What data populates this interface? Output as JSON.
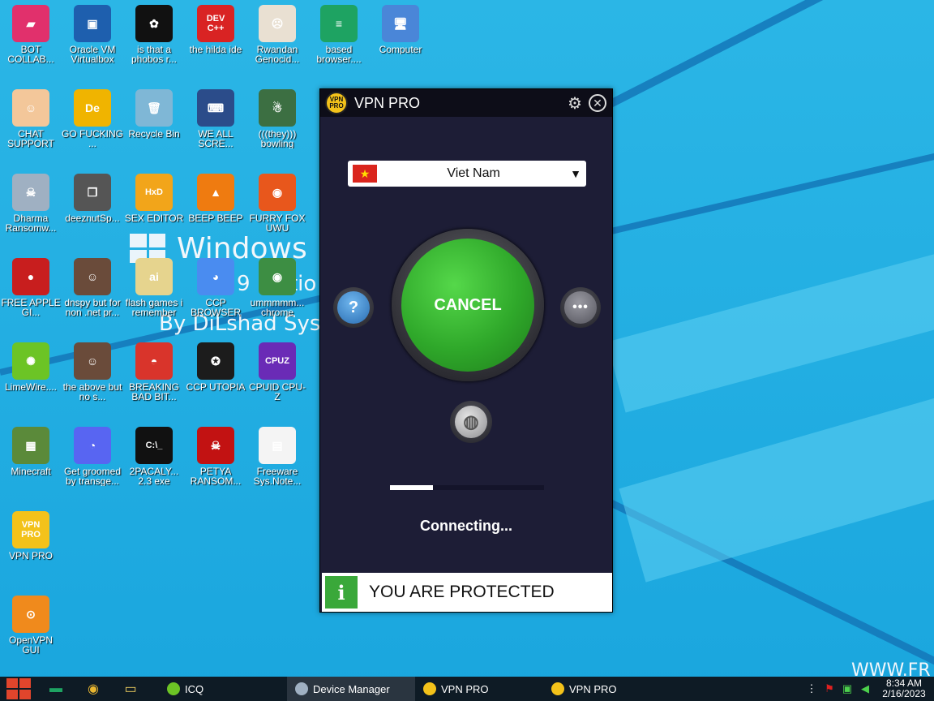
{
  "desktop": {
    "icons": [
      {
        "label": "BOT COLLAB...",
        "glyph": "▰",
        "color": "#e1306c"
      },
      {
        "label": "Oracle VM Virtualbox",
        "glyph": "▣",
        "color": "#1e5fae"
      },
      {
        "label": "is that a phobos r...",
        "glyph": "✿",
        "color": "#111111"
      },
      {
        "label": "the hilda ide",
        "glyph": "DEV C++",
        "color": "#d92323"
      },
      {
        "label": "Rwandan Genocid...",
        "glyph": "☹",
        "color": "#e9e0d2"
      },
      {
        "label": "based browser....",
        "glyph": "≡",
        "color": "#1ea362"
      },
      {
        "label": "Computer",
        "glyph": "🖥",
        "color": "#4a86d8"
      },
      {
        "label": "CHAT SUPPORT",
        "glyph": "☺",
        "color": "#f3c79a"
      },
      {
        "label": "GO FUCKING ...",
        "glyph": "De",
        "color": "#f0b400"
      },
      {
        "label": "Recycle Bin",
        "glyph": "🗑",
        "color": "#7fb7d6"
      },
      {
        "label": "WE ALL SCRE...",
        "glyph": "⌨",
        "color": "#2b4c8a"
      },
      {
        "label": "(((they))) bowling",
        "glyph": "☃",
        "color": "#3c6f42"
      },
      {
        "label": "Dharma Ransomw...",
        "glyph": "☠",
        "color": "#9fb0c2"
      },
      {
        "label": "deeznutSp...",
        "glyph": "❐",
        "color": "#555555"
      },
      {
        "label": "SEX EDITOR",
        "glyph": "HxD",
        "color": "#f2a51a"
      },
      {
        "label": "BEEP BEEP",
        "glyph": "▲",
        "color": "#ef7b10"
      },
      {
        "label": "FURRY FOX UWU",
        "glyph": "◉",
        "color": "#e8571c"
      },
      {
        "label": "FREE APPLE GI...",
        "glyph": "●",
        "color": "#c81e1e"
      },
      {
        "label": "dnspy but for non .net pr...",
        "glyph": "☺",
        "color": "#6a4b3a"
      },
      {
        "label": "flash games i remember",
        "glyph": "ai",
        "color": "#e6d48e"
      },
      {
        "label": "CCP BROWSER",
        "glyph": "◕",
        "color": "#4a8cf0"
      },
      {
        "label": "ummmmm... chrome",
        "glyph": "◉",
        "color": "#3d8e43"
      },
      {
        "label": "LimeWire....",
        "glyph": "✺",
        "color": "#6cc425"
      },
      {
        "label": "the above but no s...",
        "glyph": "☺",
        "color": "#6a4b3a"
      },
      {
        "label": "BREAKING BAD BIT...",
        "glyph": "◓",
        "color": "#d9342b"
      },
      {
        "label": "CCP UTOPIA",
        "glyph": "✪",
        "color": "#1c1c1c"
      },
      {
        "label": "CPUID CPU-Z",
        "glyph": "CPUZ",
        "color": "#6a2bb6"
      },
      {
        "label": "Minecraft",
        "glyph": "▦",
        "color": "#5b8a3a"
      },
      {
        "label": "Get groomed by transge...",
        "glyph": "◔",
        "color": "#5865f2"
      },
      {
        "label": "2PACALY... 2.3 exe",
        "glyph": "C:\\_",
        "color": "#111111"
      },
      {
        "label": "PETYA RANSOM...",
        "glyph": "☠",
        "color": "#c21212"
      },
      {
        "label": "Freeware Sys.Note...",
        "glyph": "▤",
        "color": "#f4f4f4"
      },
      {
        "label": "VPN PRO",
        "glyph": "VPN PRO",
        "color": "#f3c21a"
      },
      {
        "label": "OpenVPN GUI",
        "glyph": "⊙",
        "color": "#f08a1c"
      }
    ],
    "wallpaper": {
      "brand": "Windows",
      "edition_fragment": "9 Editio",
      "credit": "By DiLshad Sys",
      "watermark_fragment": "WWW.FR"
    }
  },
  "vpn_window": {
    "title": "VPN PRO",
    "logo_text": "VPN PRO",
    "settings_icon": "gear-icon",
    "close_icon": "close-icon",
    "country": "Viet Nam",
    "country_flag": "vietnam-flag-icon",
    "main_button_label": "CANCEL",
    "help_label": "?",
    "more_label": "•••",
    "progress": 0.28,
    "status": "Connecting...",
    "protected_label": "YOU ARE PROTECTED",
    "info_label": "i",
    "accent_color": "#2fa82a",
    "bg_color": "#1d1d36"
  },
  "taskbar": {
    "tasks": [
      {
        "label": "ICQ",
        "icon": "icq-icon",
        "color": "#6cc425",
        "active": false
      },
      {
        "label": "Device Manager",
        "icon": "device-manager-icon",
        "color": "#9fb0c2",
        "active": true
      },
      {
        "label": "VPN PRO",
        "icon": "vpn-pro-icon",
        "color": "#f3c21a",
        "active": false
      },
      {
        "label": "VPN PRO",
        "icon": "vpn-pro-icon",
        "color": "#f3c21a",
        "active": false
      }
    ],
    "time": "8:34 AM",
    "date": "2/16/2023"
  }
}
